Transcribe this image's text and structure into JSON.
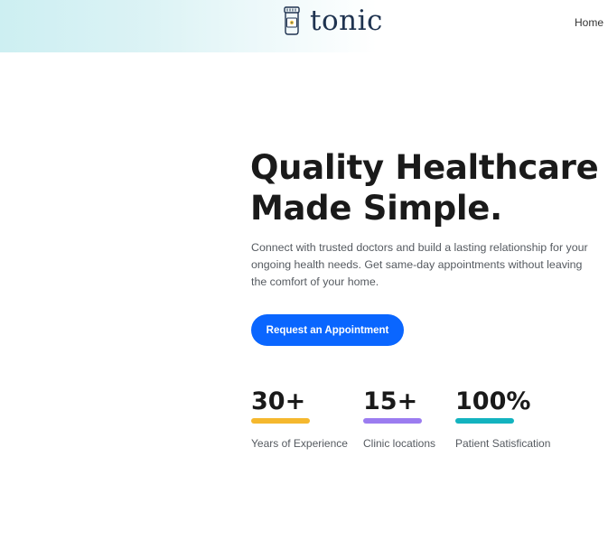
{
  "header": {
    "brand": "tonic",
    "nav": {
      "home_label": "Home"
    }
  },
  "hero": {
    "title_line1": "Quality Healthcare",
    "title_line2": "Made Simple.",
    "description": "Connect with trusted doctors and build a lasting relationship for your ongoing health needs. Get same-day appointments without leaving the comfort of your home.",
    "cta_label": "Request an Appointment"
  },
  "stats": [
    {
      "value": "30+",
      "label": "Years of Experience",
      "color": "#f5b82e"
    },
    {
      "value": "15+",
      "label": "Clinic locations",
      "color": "#9b7cf0"
    },
    {
      "value": "100%",
      "label": "Patient Satisfication",
      "color": "#13b3bf"
    }
  ],
  "colors": {
    "accent": "#0a66ff",
    "brand_text": "#1f3350"
  },
  "icons": {
    "logo": "pill-bottle-icon"
  }
}
